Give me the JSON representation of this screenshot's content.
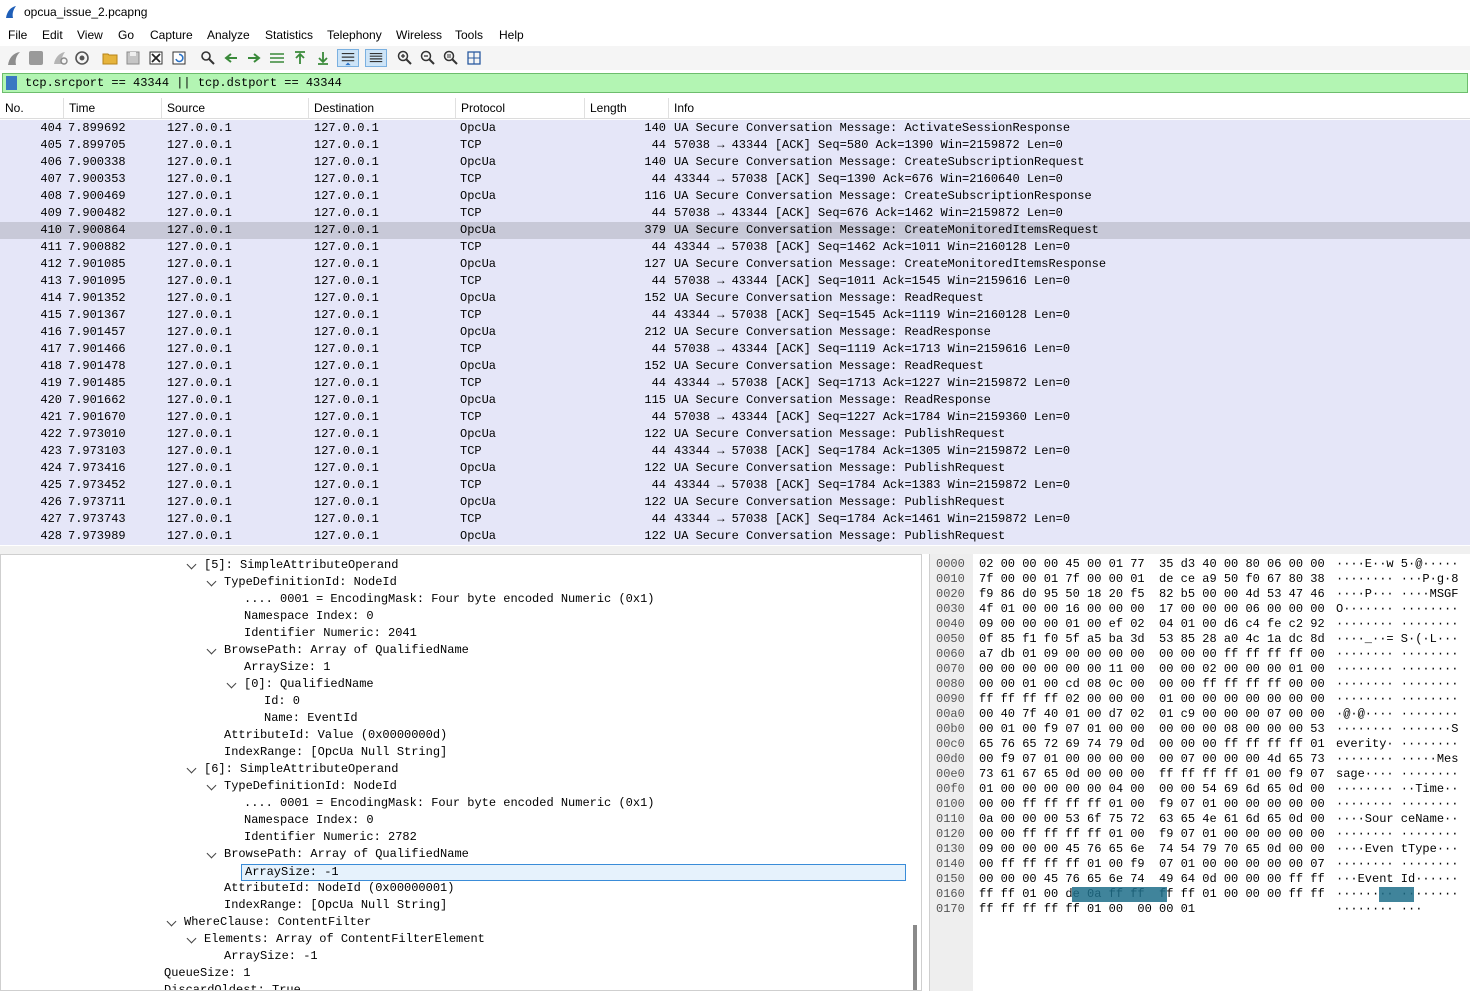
{
  "window": {
    "title": "opcua_issue_2.pcapng"
  },
  "menu": [
    "File",
    "Edit",
    "View",
    "Go",
    "Capture",
    "Analyze",
    "Statistics",
    "Telephony",
    "Wireless",
    "Tools",
    "Help"
  ],
  "toolbar_icons": [
    "shark-fin-start-icon",
    "stop-capture-icon",
    "restart-capture-icon",
    "capture-options-icon",
    "open-file-icon",
    "save-file-icon",
    "close-file-icon",
    "reload-file-icon",
    "find-packet-icon",
    "go-back-icon",
    "go-forward-icon",
    "go-to-packet-icon",
    "go-first-packet-icon",
    "go-last-packet-icon",
    "auto-scroll-icon",
    "colorize-icon",
    "zoom-in-icon",
    "zoom-out-icon",
    "zoom-normal-icon",
    "resize-columns-icon"
  ],
  "filter": {
    "text": "tcp.srcport == 43344 || tcp.dstport == 43344"
  },
  "columns": [
    "No.",
    "Time",
    "Source",
    "Destination",
    "Protocol",
    "Length",
    "Info"
  ],
  "packets": [
    {
      "no": "404",
      "time": "7.899692",
      "src": "127.0.0.1",
      "dst": "127.0.0.1",
      "proto": "OpcUa",
      "len": "140",
      "info": "UA Secure Conversation Message: ActivateSessionResponse"
    },
    {
      "no": "405",
      "time": "7.899705",
      "src": "127.0.0.1",
      "dst": "127.0.0.1",
      "proto": "TCP",
      "len": "44",
      "info": "57038 → 43344 [ACK] Seq=580 Ack=1390 Win=2159872 Len=0"
    },
    {
      "no": "406",
      "time": "7.900338",
      "src": "127.0.0.1",
      "dst": "127.0.0.1",
      "proto": "OpcUa",
      "len": "140",
      "info": "UA Secure Conversation Message: CreateSubscriptionRequest"
    },
    {
      "no": "407",
      "time": "7.900353",
      "src": "127.0.0.1",
      "dst": "127.0.0.1",
      "proto": "TCP",
      "len": "44",
      "info": "43344 → 57038 [ACK] Seq=1390 Ack=676 Win=2160640 Len=0"
    },
    {
      "no": "408",
      "time": "7.900469",
      "src": "127.0.0.1",
      "dst": "127.0.0.1",
      "proto": "OpcUa",
      "len": "116",
      "info": "UA Secure Conversation Message: CreateSubscriptionResponse"
    },
    {
      "no": "409",
      "time": "7.900482",
      "src": "127.0.0.1",
      "dst": "127.0.0.1",
      "proto": "TCP",
      "len": "44",
      "info": "57038 → 43344 [ACK] Seq=676 Ack=1462 Win=2159872 Len=0"
    },
    {
      "no": "410",
      "time": "7.900864",
      "src": "127.0.0.1",
      "dst": "127.0.0.1",
      "proto": "OpcUa",
      "len": "379",
      "info": "UA Secure Conversation Message: CreateMonitoredItemsRequest"
    },
    {
      "no": "411",
      "time": "7.900882",
      "src": "127.0.0.1",
      "dst": "127.0.0.1",
      "proto": "TCP",
      "len": "44",
      "info": "43344 → 57038 [ACK] Seq=1462 Ack=1011 Win=2160128 Len=0"
    },
    {
      "no": "412",
      "time": "7.901085",
      "src": "127.0.0.1",
      "dst": "127.0.0.1",
      "proto": "OpcUa",
      "len": "127",
      "info": "UA Secure Conversation Message: CreateMonitoredItemsResponse"
    },
    {
      "no": "413",
      "time": "7.901095",
      "src": "127.0.0.1",
      "dst": "127.0.0.1",
      "proto": "TCP",
      "len": "44",
      "info": "57038 → 43344 [ACK] Seq=1011 Ack=1545 Win=2159616 Len=0"
    },
    {
      "no": "414",
      "time": "7.901352",
      "src": "127.0.0.1",
      "dst": "127.0.0.1",
      "proto": "OpcUa",
      "len": "152",
      "info": "UA Secure Conversation Message: ReadRequest"
    },
    {
      "no": "415",
      "time": "7.901367",
      "src": "127.0.0.1",
      "dst": "127.0.0.1",
      "proto": "TCP",
      "len": "44",
      "info": "43344 → 57038 [ACK] Seq=1545 Ack=1119 Win=2160128 Len=0"
    },
    {
      "no": "416",
      "time": "7.901457",
      "src": "127.0.0.1",
      "dst": "127.0.0.1",
      "proto": "OpcUa",
      "len": "212",
      "info": "UA Secure Conversation Message: ReadResponse"
    },
    {
      "no": "417",
      "time": "7.901466",
      "src": "127.0.0.1",
      "dst": "127.0.0.1",
      "proto": "TCP",
      "len": "44",
      "info": "57038 → 43344 [ACK] Seq=1119 Ack=1713 Win=2159616 Len=0"
    },
    {
      "no": "418",
      "time": "7.901478",
      "src": "127.0.0.1",
      "dst": "127.0.0.1",
      "proto": "OpcUa",
      "len": "152",
      "info": "UA Secure Conversation Message: ReadRequest"
    },
    {
      "no": "419",
      "time": "7.901485",
      "src": "127.0.0.1",
      "dst": "127.0.0.1",
      "proto": "TCP",
      "len": "44",
      "info": "43344 → 57038 [ACK] Seq=1713 Ack=1227 Win=2159872 Len=0"
    },
    {
      "no": "420",
      "time": "7.901662",
      "src": "127.0.0.1",
      "dst": "127.0.0.1",
      "proto": "OpcUa",
      "len": "115",
      "info": "UA Secure Conversation Message: ReadResponse"
    },
    {
      "no": "421",
      "time": "7.901670",
      "src": "127.0.0.1",
      "dst": "127.0.0.1",
      "proto": "TCP",
      "len": "44",
      "info": "57038 → 43344 [ACK] Seq=1227 Ack=1784 Win=2159360 Len=0"
    },
    {
      "no": "422",
      "time": "7.973010",
      "src": "127.0.0.1",
      "dst": "127.0.0.1",
      "proto": "OpcUa",
      "len": "122",
      "info": "UA Secure Conversation Message: PublishRequest"
    },
    {
      "no": "423",
      "time": "7.973103",
      "src": "127.0.0.1",
      "dst": "127.0.0.1",
      "proto": "TCP",
      "len": "44",
      "info": "43344 → 57038 [ACK] Seq=1784 Ack=1305 Win=2159872 Len=0"
    },
    {
      "no": "424",
      "time": "7.973416",
      "src": "127.0.0.1",
      "dst": "127.0.0.1",
      "proto": "OpcUa",
      "len": "122",
      "info": "UA Secure Conversation Message: PublishRequest"
    },
    {
      "no": "425",
      "time": "7.973452",
      "src": "127.0.0.1",
      "dst": "127.0.0.1",
      "proto": "TCP",
      "len": "44",
      "info": "43344 → 57038 [ACK] Seq=1784 Ack=1383 Win=2159872 Len=0"
    },
    {
      "no": "426",
      "time": "7.973711",
      "src": "127.0.0.1",
      "dst": "127.0.0.1",
      "proto": "OpcUa",
      "len": "122",
      "info": "UA Secure Conversation Message: PublishRequest"
    },
    {
      "no": "427",
      "time": "7.973743",
      "src": "127.0.0.1",
      "dst": "127.0.0.1",
      "proto": "TCP",
      "len": "44",
      "info": "43344 → 57038 [ACK] Seq=1784 Ack=1461 Win=2159872 Len=0"
    },
    {
      "no": "428",
      "time": "7.973989",
      "src": "127.0.0.1",
      "dst": "127.0.0.1",
      "proto": "OpcUa",
      "len": "122",
      "info": "UA Secure Conversation Message: PublishRequest"
    }
  ],
  "selected_packet": "410",
  "details": [
    {
      "depth": 0,
      "exp": "open",
      "text": "[5]: SimpleAttributeOperand"
    },
    {
      "depth": 1,
      "exp": "open",
      "text": "TypeDefinitionId: NodeId"
    },
    {
      "depth": 2,
      "exp": "none",
      "text": ".... 0001 = EncodingMask: Four byte encoded Numeric (0x1)"
    },
    {
      "depth": 2,
      "exp": "none",
      "text": "Namespace Index: 0"
    },
    {
      "depth": 2,
      "exp": "none",
      "text": "Identifier Numeric: 2041"
    },
    {
      "depth": 1,
      "exp": "open",
      "text": "BrowsePath: Array of QualifiedName"
    },
    {
      "depth": 2,
      "exp": "none",
      "text": "ArraySize: 1"
    },
    {
      "depth": 2,
      "exp": "open",
      "text": "[0]: QualifiedName"
    },
    {
      "depth": 3,
      "exp": "none",
      "text": "Id: 0"
    },
    {
      "depth": 3,
      "exp": "none",
      "text": "Name: EventId"
    },
    {
      "depth": 1,
      "exp": "none",
      "text": "AttributeId: Value (0x0000000d)"
    },
    {
      "depth": 1,
      "exp": "none",
      "text": "IndexRange: [OpcUa Null String]"
    },
    {
      "depth": 0,
      "exp": "open",
      "text": "[6]: SimpleAttributeOperand"
    },
    {
      "depth": 1,
      "exp": "open",
      "text": "TypeDefinitionId: NodeId"
    },
    {
      "depth": 2,
      "exp": "none",
      "text": ".... 0001 = EncodingMask: Four byte encoded Numeric (0x1)"
    },
    {
      "depth": 2,
      "exp": "none",
      "text": "Namespace Index: 0"
    },
    {
      "depth": 2,
      "exp": "none",
      "text": "Identifier Numeric: 2782"
    },
    {
      "depth": 1,
      "exp": "open",
      "text": "BrowsePath: Array of QualifiedName"
    },
    {
      "depth": 2,
      "exp": "none",
      "text": "ArraySize: -1",
      "selected": true
    },
    {
      "depth": 1,
      "exp": "none",
      "text": "AttributeId: NodeId (0x00000001)"
    },
    {
      "depth": 1,
      "exp": "none",
      "text": "IndexRange: [OpcUa Null String]"
    },
    {
      "depth": -1,
      "exp": "open",
      "text": "WhereClause: ContentFilter"
    },
    {
      "depth": 0,
      "exp": "open",
      "text": "Elements: Array of ContentFilterElement"
    },
    {
      "depth": 1,
      "exp": "none",
      "text": "ArraySize: -1"
    },
    {
      "depth": -2,
      "exp": "none",
      "text": "QueueSize: 1"
    },
    {
      "depth": -2,
      "exp": "none",
      "text": "DiscardOldest: True"
    }
  ],
  "hex": [
    {
      "off": "0000",
      "hex": "02 00 00 00 45 00 01 77  35 d3 40 00 80 06 00 00",
      "ascii": "····E··w 5·@·····"
    },
    {
      "off": "0010",
      "hex": "7f 00 00 01 7f 00 00 01  de ce a9 50 f0 67 80 38",
      "ascii": "········ ···P·g·8"
    },
    {
      "off": "0020",
      "hex": "f9 86 d0 95 50 18 20 f5  82 b5 00 00 4d 53 47 46",
      "ascii": "····P··· ····MSGF"
    },
    {
      "off": "0030",
      "hex": "4f 01 00 00 16 00 00 00  17 00 00 00 06 00 00 00",
      "ascii": "O······· ········"
    },
    {
      "off": "0040",
      "hex": "09 00 00 00 01 00 ef 02  04 01 00 d6 c4 fe c2 92",
      "ascii": "········ ········"
    },
    {
      "off": "0050",
      "hex": "0f 85 f1 f0 5f a5 ba 3d  53 85 28 a0 4c 1a dc 8d",
      "ascii": "····_··= S·(·L···"
    },
    {
      "off": "0060",
      "hex": "a7 db 01 09 00 00 00 00  00 00 00 ff ff ff ff 00",
      "ascii": "········ ········"
    },
    {
      "off": "0070",
      "hex": "00 00 00 00 00 00 11 00  00 00 02 00 00 00 01 00",
      "ascii": "········ ········"
    },
    {
      "off": "0080",
      "hex": "00 00 01 00 cd 08 0c 00  00 00 ff ff ff ff 00 00",
      "ascii": "········ ········"
    },
    {
      "off": "0090",
      "hex": "ff ff ff ff 02 00 00 00  01 00 00 00 00 00 00 00",
      "ascii": "········ ········"
    },
    {
      "off": "00a0",
      "hex": "00 40 7f 40 01 00 d7 02  01 c9 00 00 00 07 00 00",
      "ascii": "·@·@···· ········"
    },
    {
      "off": "00b0",
      "hex": "00 01 00 f9 07 01 00 00  00 00 00 08 00 00 00 53",
      "ascii": "········ ·······S"
    },
    {
      "off": "00c0",
      "hex": "65 76 65 72 69 74 79 0d  00 00 00 ff ff ff ff 01",
      "ascii": "everity· ········"
    },
    {
      "off": "00d0",
      "hex": "00 f9 07 01 00 00 00 00  00 07 00 00 00 4d 65 73",
      "ascii": "········ ·····Mes"
    },
    {
      "off": "00e0",
      "hex": "73 61 67 65 0d 00 00 00  ff ff ff ff 01 00 f9 07",
      "ascii": "sage···· ········"
    },
    {
      "off": "00f0",
      "hex": "01 00 00 00 00 00 04 00  00 00 54 69 6d 65 0d 00",
      "ascii": "········ ··Time··"
    },
    {
      "off": "0100",
      "hex": "00 00 ff ff ff ff 01 00  f9 07 01 00 00 00 00 00",
      "ascii": "········ ········"
    },
    {
      "off": "0110",
      "hex": "0a 00 00 00 53 6f 75 72  63 65 4e 61 6d 65 0d 00",
      "ascii": "····Sour ceName··"
    },
    {
      "off": "0120",
      "hex": "00 00 ff ff ff ff 01 00  f9 07 01 00 00 00 00 00",
      "ascii": "········ ········"
    },
    {
      "off": "0130",
      "hex": "09 00 00 00 45 76 65 6e  74 54 79 70 65 0d 00 00",
      "ascii": "····Even tType···"
    },
    {
      "off": "0140",
      "hex": "00 ff ff ff ff 01 00 f9  07 01 00 00 00 00 00 07",
      "ascii": "········ ········"
    },
    {
      "off": "0150",
      "hex": "00 00 00 45 76 65 6e 74  49 64 0d 00 00 00 ff ff",
      "ascii": "···Event Id······"
    },
    {
      "off": "0160",
      "hex": "ff ff 01 00 de 0a ff ff  ff ff 01 00 00 00 ff ff",
      "ascii": "········ ········",
      "hl": true
    },
    {
      "off": "0170",
      "hex": "ff ff ff ff ff 01 00  00 00 01",
      "ascii": "········ ···"
    }
  ]
}
